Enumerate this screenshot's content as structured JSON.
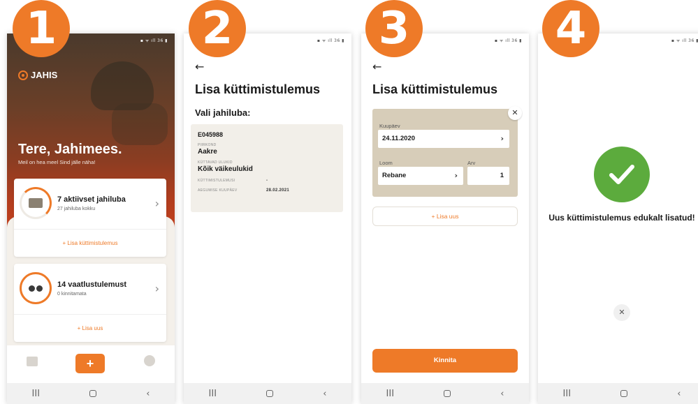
{
  "steps": [
    "1",
    "2",
    "3",
    "4"
  ],
  "colors": {
    "accent": "#ee7a28",
    "success": "#5cab3d"
  },
  "statusbar": "▪ ᯤ ıll 36 ▮",
  "navbar": {
    "recents": "III",
    "back": "‹"
  },
  "screen1": {
    "brand": "JAHIS",
    "greeting": "Tere, Jahimees.",
    "greeting_sub": "Meil on hea meel Sind jälle näha!",
    "card1": {
      "title": "7 aktiivset jahiluba",
      "subtitle": "27 jahiluba kokku",
      "action": "+ Lisa küttimistulemus",
      "icon": "permit-card-icon"
    },
    "card2": {
      "title": "14 vaatlustulemust",
      "subtitle": "0 kinnitamata",
      "action": "+ Lisa uus",
      "icon": "binoculars-icon"
    },
    "bottom_nav": {
      "add": "+"
    }
  },
  "screen2": {
    "title": "Lisa küttimistulemus",
    "subtitle": "Vali jahiluba:",
    "permit": {
      "id": "E045988",
      "area_label": "PIIRKOND",
      "area": "Aakre",
      "species_label": "KÜTTAVAD ULUKID",
      "species": "Kõik väikeulukid",
      "result_label": "KÜTTIMISTULEMUSI",
      "result_value": "-",
      "valid_label": "AEGUMISE KUUPÄEV",
      "valid_value": "28.02.2021"
    }
  },
  "screen3": {
    "title": "Lisa küttimistulemus",
    "date_label": "Kuupäev",
    "date_value": "24.11.2020",
    "animal_label": "Loom",
    "animal_value": "Rebane",
    "count_label": "Arv",
    "count_value": "1",
    "add_new": "+ Lisa uus",
    "confirm": "Kinnita"
  },
  "screen4": {
    "message": "Uus küttimistulemus edukalt lisatud!"
  }
}
